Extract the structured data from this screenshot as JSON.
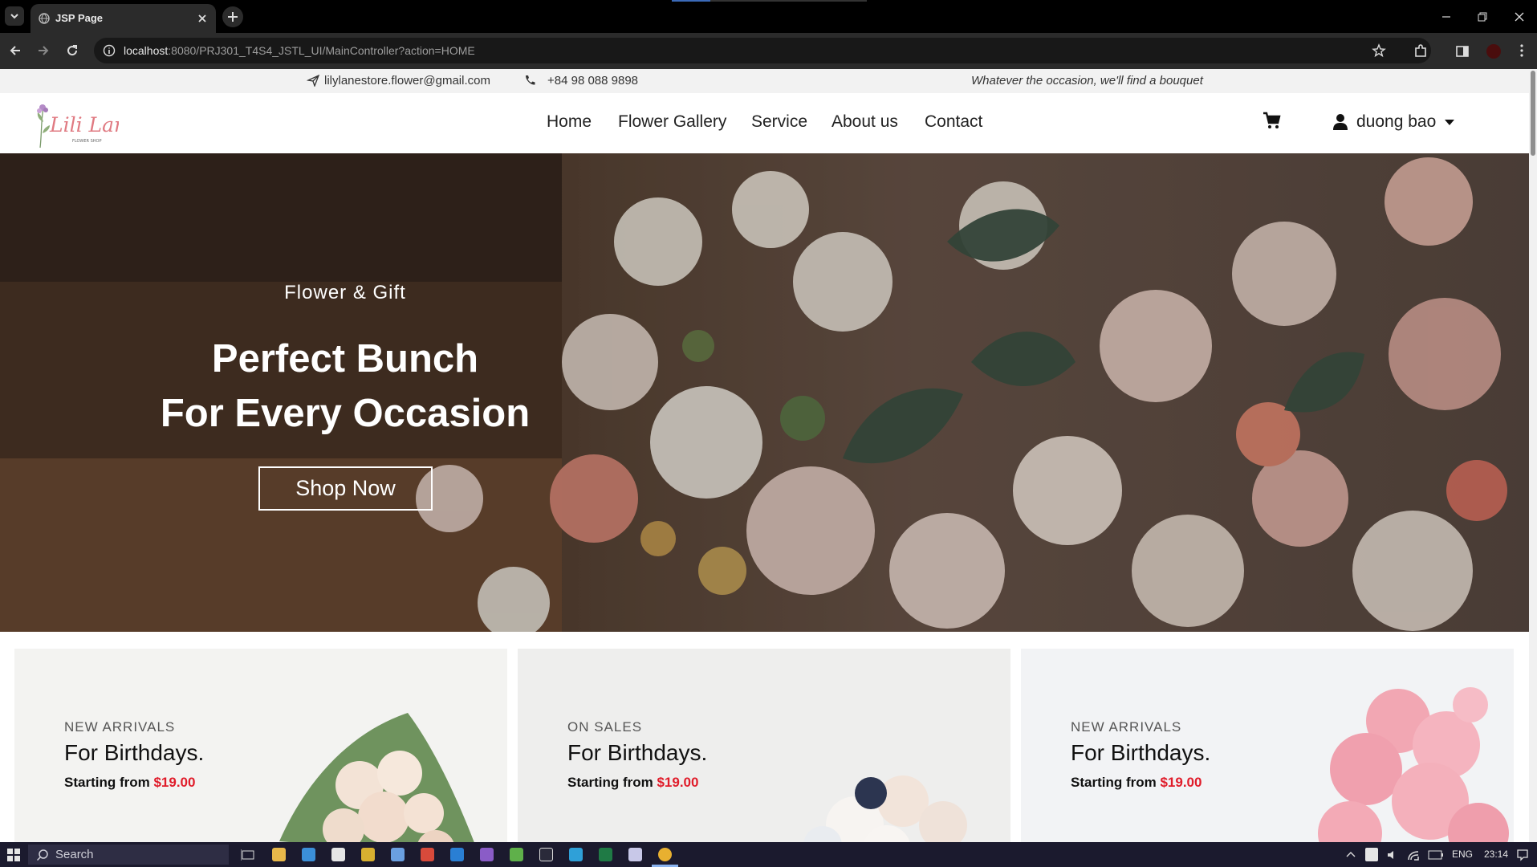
{
  "browser": {
    "tab_title": "JSP Page",
    "url_host": "localhost",
    "url_path": ":8080/PRJ301_T4S4_JSTL_UI/MainController?action=HOME",
    "icons": [
      "tab-dropdown-icon",
      "globe-icon",
      "close-icon",
      "plus-icon",
      "back-icon",
      "forward-icon",
      "reload-icon",
      "site-info-icon",
      "star-icon",
      "extensions-icon",
      "side-panel-icon",
      "profile-icon",
      "menu-icon",
      "minimize-icon",
      "restore-icon",
      "close-window-icon"
    ]
  },
  "topbar": {
    "email": "lilylanestore.flower@gmail.com",
    "phone": "+84 98 088 9898",
    "tagline": "Whatever the occasion, we'll find a bouquet"
  },
  "nav": {
    "logo_text": "Lili Lane",
    "logo_subtext": "FLOWER SHOP",
    "links": [
      "Home",
      "Flower Gallery",
      "Service",
      "About us",
      "Contact"
    ],
    "username": "duong bao"
  },
  "hero": {
    "subtitle": "Flower & Gift",
    "title_line1": "Perfect Bunch",
    "title_line2": "For Every Occasion",
    "button": "Shop Now"
  },
  "cards": [
    {
      "label": "NEW ARRIVALS",
      "title": "For Birthdays.",
      "starting": "Starting from ",
      "price": "$19.00"
    },
    {
      "label": "ON SALES",
      "title": "For Birthdays.",
      "starting": "Starting from ",
      "price": "$19.00"
    },
    {
      "label": "NEW ARRIVALS",
      "title": "For Birthdays.",
      "starting": "Starting from ",
      "price": "$19.00"
    }
  ],
  "taskbar": {
    "search_placeholder": "Search",
    "language": "ENG",
    "time": "23:14"
  },
  "colors": {
    "price_red": "#e01c2a",
    "taskbar_bg": "#1b1a2e",
    "chrome_bg": "#2b2b2b"
  }
}
